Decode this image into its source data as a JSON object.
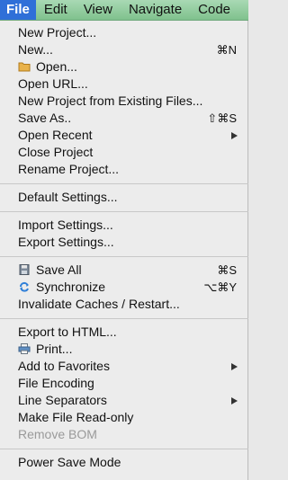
{
  "menubar": {
    "items": [
      "File",
      "Edit",
      "View",
      "Navigate",
      "Code"
    ]
  },
  "menu": {
    "new_project": "New Project...",
    "new": "New...",
    "new_shortcut": "⌘N",
    "open": "Open...",
    "open_url": "Open URL...",
    "new_from_existing": "New Project from Existing Files...",
    "save_as": "Save As..",
    "save_as_shortcut": "⇧⌘S",
    "open_recent": "Open Recent",
    "close_project": "Close Project",
    "rename_project": "Rename Project...",
    "default_settings": "Default Settings...",
    "import_settings": "Import Settings...",
    "export_settings": "Export Settings...",
    "save_all": "Save All",
    "save_all_shortcut": "⌘S",
    "synchronize": "Synchronize",
    "synchronize_shortcut": "⌥⌘Y",
    "invalidate_caches": "Invalidate Caches / Restart...",
    "export_html": "Export to HTML...",
    "print": "Print...",
    "add_favorites": "Add to Favorites",
    "file_encoding": "File Encoding",
    "line_separators": "Line Separators",
    "make_read_only": "Make File Read-only",
    "remove_bom": "Remove BOM",
    "power_save": "Power Save Mode"
  },
  "icons": {
    "open": "folder-icon",
    "save_all": "floppy-disk-icon",
    "synchronize": "sync-icon",
    "print": "printer-icon",
    "submenu": "chevron-right-icon"
  },
  "colors": {
    "menubar": "#8fcb9b",
    "active_menu": "#2f6fd8",
    "menu_bg": "#ececec",
    "disabled_text": "#9a9a9a"
  }
}
